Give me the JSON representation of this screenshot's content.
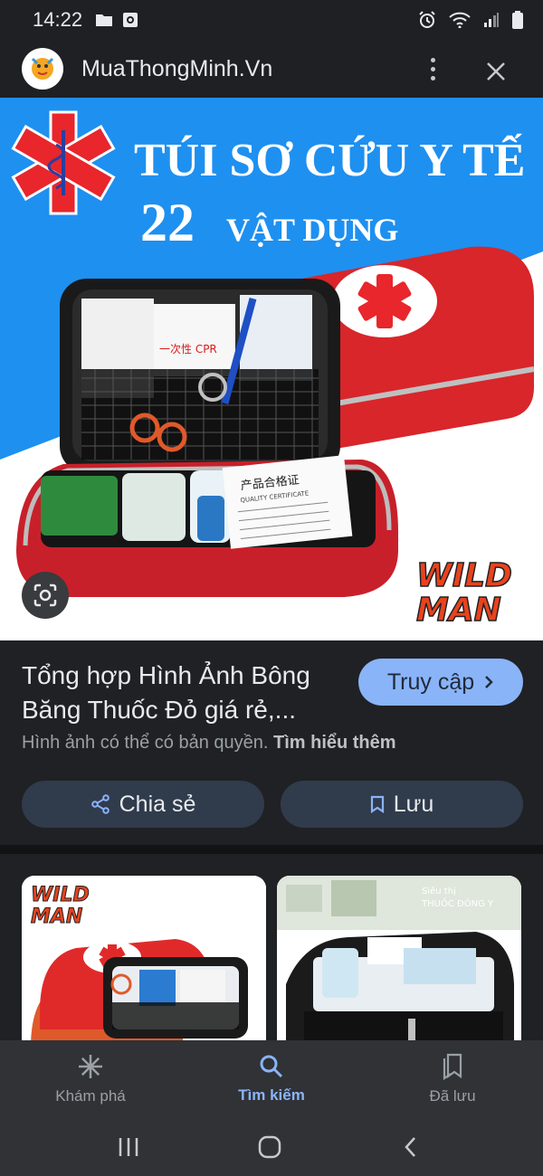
{
  "status_bar": {
    "time": "14:22",
    "icons": [
      "folder-icon",
      "screen-record-icon",
      "alarm-icon",
      "wifi-icon",
      "signal-icon",
      "battery-icon"
    ]
  },
  "site": {
    "name": "MuaThongMinh.Vn",
    "avatar_icon": "site-logo-icon"
  },
  "main_image": {
    "headline_1": "TÚI SƠ CỨU Y TẾ",
    "headline_2_number": "22",
    "headline_2_text": "VẬT DỤNG",
    "brand_line_1": "WILD",
    "brand_line_2": "MAN",
    "cpr_label": "一次性 CPR",
    "certificate_title": "产品合格证",
    "certificate_sub": "QUALITY CERTIFICATE"
  },
  "info": {
    "title": "Tổng hợp Hình Ảnh Bông Băng Thuốc Đỏ giá rẻ,...",
    "visit_label": "Truy cập",
    "copyright_text": "Hình ảnh có thể có bản quyền.",
    "learn_more": "Tìm hiểu thêm",
    "share_label": "Chia sẻ",
    "save_label": "Lưu"
  },
  "related": {
    "card1_brand_1": "WILD",
    "card1_brand_2": "MAN",
    "card2_watermark_1": "Siêu thị",
    "card2_watermark_2": "THUỐC ĐÔNG Y"
  },
  "bottom_nav": {
    "items": [
      {
        "label": "Khám phá",
        "icon": "asterisk-icon"
      },
      {
        "label": "Tìm kiếm",
        "icon": "search-icon"
      },
      {
        "label": "Đã lưu",
        "icon": "bookmarks-icon"
      }
    ],
    "active_index": 1
  },
  "colors": {
    "accent": "#8ab4f8",
    "background": "#202124",
    "pill_bg": "#303b4c",
    "banner_blue": "#1e90f0",
    "case_red": "#e02a2a"
  }
}
